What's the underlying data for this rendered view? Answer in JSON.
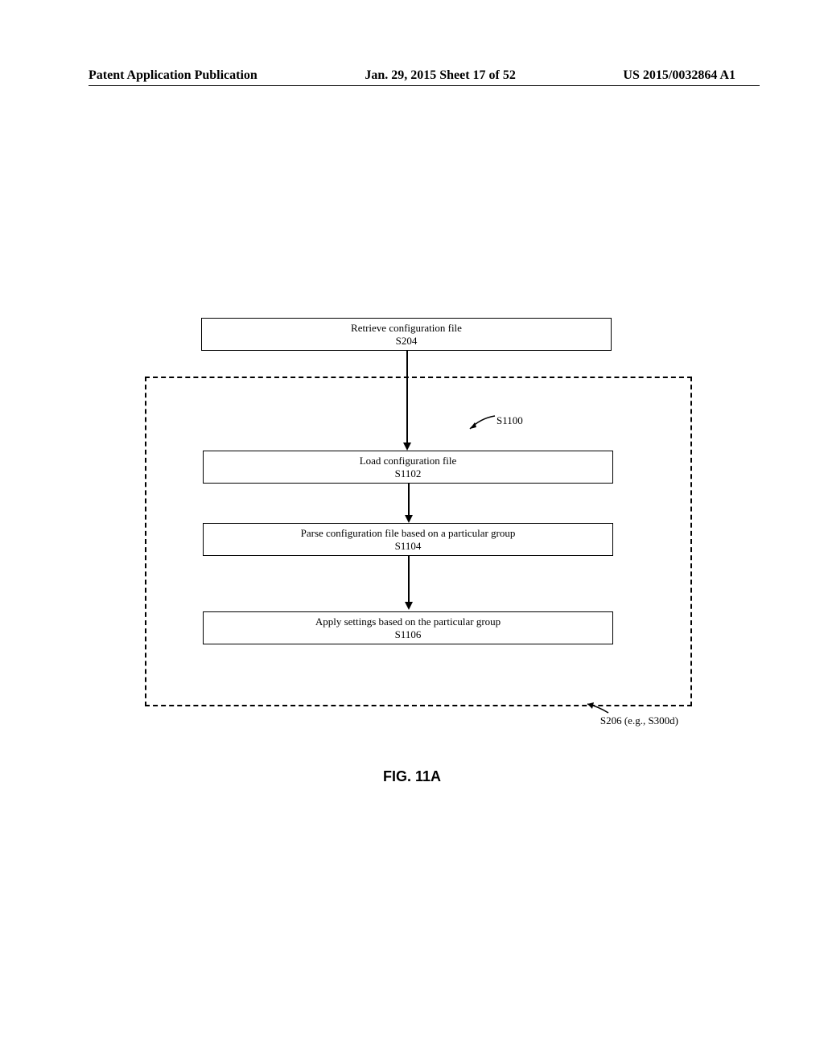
{
  "header": {
    "left": "Patent Application Publication",
    "center": "Jan. 29, 2015  Sheet 17 of 52",
    "right": "US 2015/0032864 A1"
  },
  "boxes": {
    "s204": {
      "title": "Retrieve configuration file",
      "code": "S204"
    },
    "s1102": {
      "title": "Load configuration file",
      "code": "S1102"
    },
    "s1104": {
      "title": "Parse configuration file based on a particular group",
      "code": "S1104"
    },
    "s1106": {
      "title": "Apply settings based on the particular group",
      "code": "S1106"
    }
  },
  "annotations": {
    "group_label": "S1100",
    "bottom_label": "S206 (e.g., S300d)"
  },
  "figure_label": "FIG. 11A"
}
